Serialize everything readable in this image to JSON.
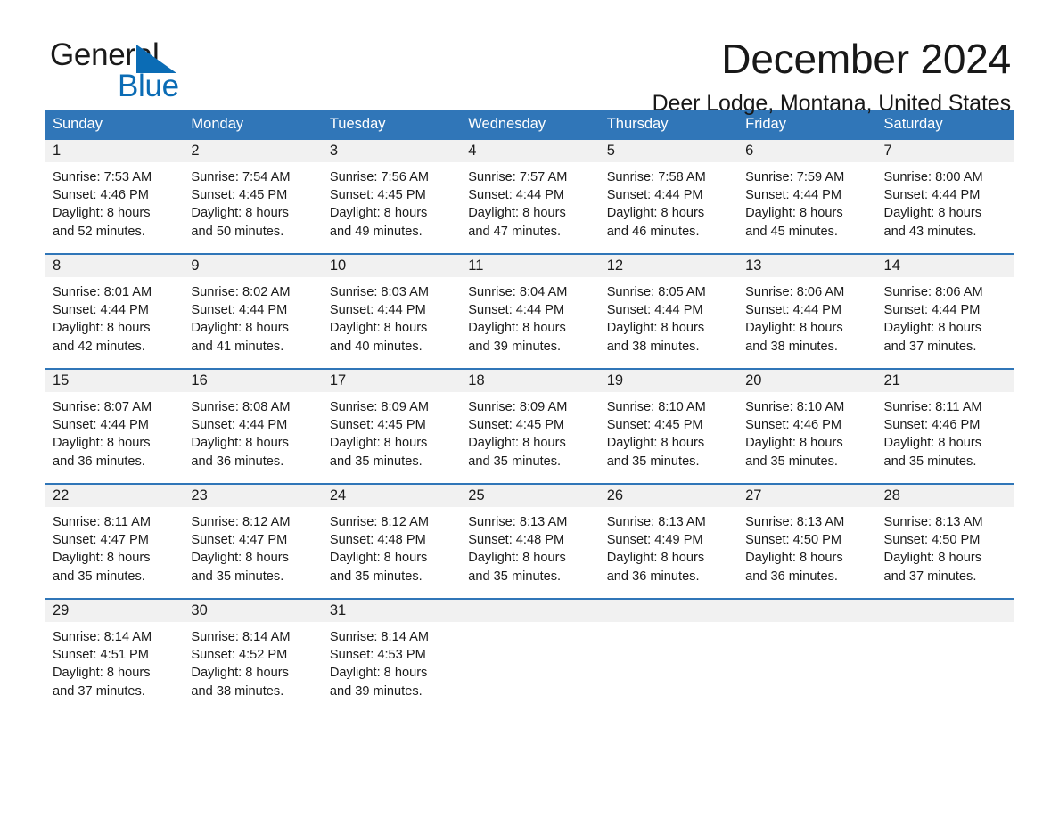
{
  "brand": {
    "name_part1": "General",
    "name_part2": "Blue",
    "accent_color": "#0b6cb5"
  },
  "header": {
    "title": "December 2024",
    "location": "Deer Lodge, Montana, United States"
  },
  "theme": {
    "header_blue": "#3076b8",
    "date_row_gray": "#f1f1f1",
    "text_color": "#1b1b1b"
  },
  "calendar": {
    "weekdays": [
      "Sunday",
      "Monday",
      "Tuesday",
      "Wednesday",
      "Thursday",
      "Friday",
      "Saturday"
    ],
    "weeks": [
      {
        "days": [
          {
            "date": "1",
            "sunrise": "Sunrise: 7:53 AM",
            "sunset": "Sunset: 4:46 PM",
            "daylight_line1": "Daylight: 8 hours",
            "daylight_line2": "and 52 minutes."
          },
          {
            "date": "2",
            "sunrise": "Sunrise: 7:54 AM",
            "sunset": "Sunset: 4:45 PM",
            "daylight_line1": "Daylight: 8 hours",
            "daylight_line2": "and 50 minutes."
          },
          {
            "date": "3",
            "sunrise": "Sunrise: 7:56 AM",
            "sunset": "Sunset: 4:45 PM",
            "daylight_line1": "Daylight: 8 hours",
            "daylight_line2": "and 49 minutes."
          },
          {
            "date": "4",
            "sunrise": "Sunrise: 7:57 AM",
            "sunset": "Sunset: 4:44 PM",
            "daylight_line1": "Daylight: 8 hours",
            "daylight_line2": "and 47 minutes."
          },
          {
            "date": "5",
            "sunrise": "Sunrise: 7:58 AM",
            "sunset": "Sunset: 4:44 PM",
            "daylight_line1": "Daylight: 8 hours",
            "daylight_line2": "and 46 minutes."
          },
          {
            "date": "6",
            "sunrise": "Sunrise: 7:59 AM",
            "sunset": "Sunset: 4:44 PM",
            "daylight_line1": "Daylight: 8 hours",
            "daylight_line2": "and 45 minutes."
          },
          {
            "date": "7",
            "sunrise": "Sunrise: 8:00 AM",
            "sunset": "Sunset: 4:44 PM",
            "daylight_line1": "Daylight: 8 hours",
            "daylight_line2": "and 43 minutes."
          }
        ]
      },
      {
        "days": [
          {
            "date": "8",
            "sunrise": "Sunrise: 8:01 AM",
            "sunset": "Sunset: 4:44 PM",
            "daylight_line1": "Daylight: 8 hours",
            "daylight_line2": "and 42 minutes."
          },
          {
            "date": "9",
            "sunrise": "Sunrise: 8:02 AM",
            "sunset": "Sunset: 4:44 PM",
            "daylight_line1": "Daylight: 8 hours",
            "daylight_line2": "and 41 minutes."
          },
          {
            "date": "10",
            "sunrise": "Sunrise: 8:03 AM",
            "sunset": "Sunset: 4:44 PM",
            "daylight_line1": "Daylight: 8 hours",
            "daylight_line2": "and 40 minutes."
          },
          {
            "date": "11",
            "sunrise": "Sunrise: 8:04 AM",
            "sunset": "Sunset: 4:44 PM",
            "daylight_line1": "Daylight: 8 hours",
            "daylight_line2": "and 39 minutes."
          },
          {
            "date": "12",
            "sunrise": "Sunrise: 8:05 AM",
            "sunset": "Sunset: 4:44 PM",
            "daylight_line1": "Daylight: 8 hours",
            "daylight_line2": "and 38 minutes."
          },
          {
            "date": "13",
            "sunrise": "Sunrise: 8:06 AM",
            "sunset": "Sunset: 4:44 PM",
            "daylight_line1": "Daylight: 8 hours",
            "daylight_line2": "and 38 minutes."
          },
          {
            "date": "14",
            "sunrise": "Sunrise: 8:06 AM",
            "sunset": "Sunset: 4:44 PM",
            "daylight_line1": "Daylight: 8 hours",
            "daylight_line2": "and 37 minutes."
          }
        ]
      },
      {
        "days": [
          {
            "date": "15",
            "sunrise": "Sunrise: 8:07 AM",
            "sunset": "Sunset: 4:44 PM",
            "daylight_line1": "Daylight: 8 hours",
            "daylight_line2": "and 36 minutes."
          },
          {
            "date": "16",
            "sunrise": "Sunrise: 8:08 AM",
            "sunset": "Sunset: 4:44 PM",
            "daylight_line1": "Daylight: 8 hours",
            "daylight_line2": "and 36 minutes."
          },
          {
            "date": "17",
            "sunrise": "Sunrise: 8:09 AM",
            "sunset": "Sunset: 4:45 PM",
            "daylight_line1": "Daylight: 8 hours",
            "daylight_line2": "and 35 minutes."
          },
          {
            "date": "18",
            "sunrise": "Sunrise: 8:09 AM",
            "sunset": "Sunset: 4:45 PM",
            "daylight_line1": "Daylight: 8 hours",
            "daylight_line2": "and 35 minutes."
          },
          {
            "date": "19",
            "sunrise": "Sunrise: 8:10 AM",
            "sunset": "Sunset: 4:45 PM",
            "daylight_line1": "Daylight: 8 hours",
            "daylight_line2": "and 35 minutes."
          },
          {
            "date": "20",
            "sunrise": "Sunrise: 8:10 AM",
            "sunset": "Sunset: 4:46 PM",
            "daylight_line1": "Daylight: 8 hours",
            "daylight_line2": "and 35 minutes."
          },
          {
            "date": "21",
            "sunrise": "Sunrise: 8:11 AM",
            "sunset": "Sunset: 4:46 PM",
            "daylight_line1": "Daylight: 8 hours",
            "daylight_line2": "and 35 minutes."
          }
        ]
      },
      {
        "days": [
          {
            "date": "22",
            "sunrise": "Sunrise: 8:11 AM",
            "sunset": "Sunset: 4:47 PM",
            "daylight_line1": "Daylight: 8 hours",
            "daylight_line2": "and 35 minutes."
          },
          {
            "date": "23",
            "sunrise": "Sunrise: 8:12 AM",
            "sunset": "Sunset: 4:47 PM",
            "daylight_line1": "Daylight: 8 hours",
            "daylight_line2": "and 35 minutes."
          },
          {
            "date": "24",
            "sunrise": "Sunrise: 8:12 AM",
            "sunset": "Sunset: 4:48 PM",
            "daylight_line1": "Daylight: 8 hours",
            "daylight_line2": "and 35 minutes."
          },
          {
            "date": "25",
            "sunrise": "Sunrise: 8:13 AM",
            "sunset": "Sunset: 4:48 PM",
            "daylight_line1": "Daylight: 8 hours",
            "daylight_line2": "and 35 minutes."
          },
          {
            "date": "26",
            "sunrise": "Sunrise: 8:13 AM",
            "sunset": "Sunset: 4:49 PM",
            "daylight_line1": "Daylight: 8 hours",
            "daylight_line2": "and 36 minutes."
          },
          {
            "date": "27",
            "sunrise": "Sunrise: 8:13 AM",
            "sunset": "Sunset: 4:50 PM",
            "daylight_line1": "Daylight: 8 hours",
            "daylight_line2": "and 36 minutes."
          },
          {
            "date": "28",
            "sunrise": "Sunrise: 8:13 AM",
            "sunset": "Sunset: 4:50 PM",
            "daylight_line1": "Daylight: 8 hours",
            "daylight_line2": "and 37 minutes."
          }
        ]
      },
      {
        "days": [
          {
            "date": "29",
            "sunrise": "Sunrise: 8:14 AM",
            "sunset": "Sunset: 4:51 PM",
            "daylight_line1": "Daylight: 8 hours",
            "daylight_line2": "and 37 minutes."
          },
          {
            "date": "30",
            "sunrise": "Sunrise: 8:14 AM",
            "sunset": "Sunset: 4:52 PM",
            "daylight_line1": "Daylight: 8 hours",
            "daylight_line2": "and 38 minutes."
          },
          {
            "date": "31",
            "sunrise": "Sunrise: 8:14 AM",
            "sunset": "Sunset: 4:53 PM",
            "daylight_line1": "Daylight: 8 hours",
            "daylight_line2": "and 39 minutes."
          },
          {
            "date": "",
            "sunrise": "",
            "sunset": "",
            "daylight_line1": "",
            "daylight_line2": ""
          },
          {
            "date": "",
            "sunrise": "",
            "sunset": "",
            "daylight_line1": "",
            "daylight_line2": ""
          },
          {
            "date": "",
            "sunrise": "",
            "sunset": "",
            "daylight_line1": "",
            "daylight_line2": ""
          },
          {
            "date": "",
            "sunrise": "",
            "sunset": "",
            "daylight_line1": "",
            "daylight_line2": ""
          }
        ]
      }
    ]
  }
}
